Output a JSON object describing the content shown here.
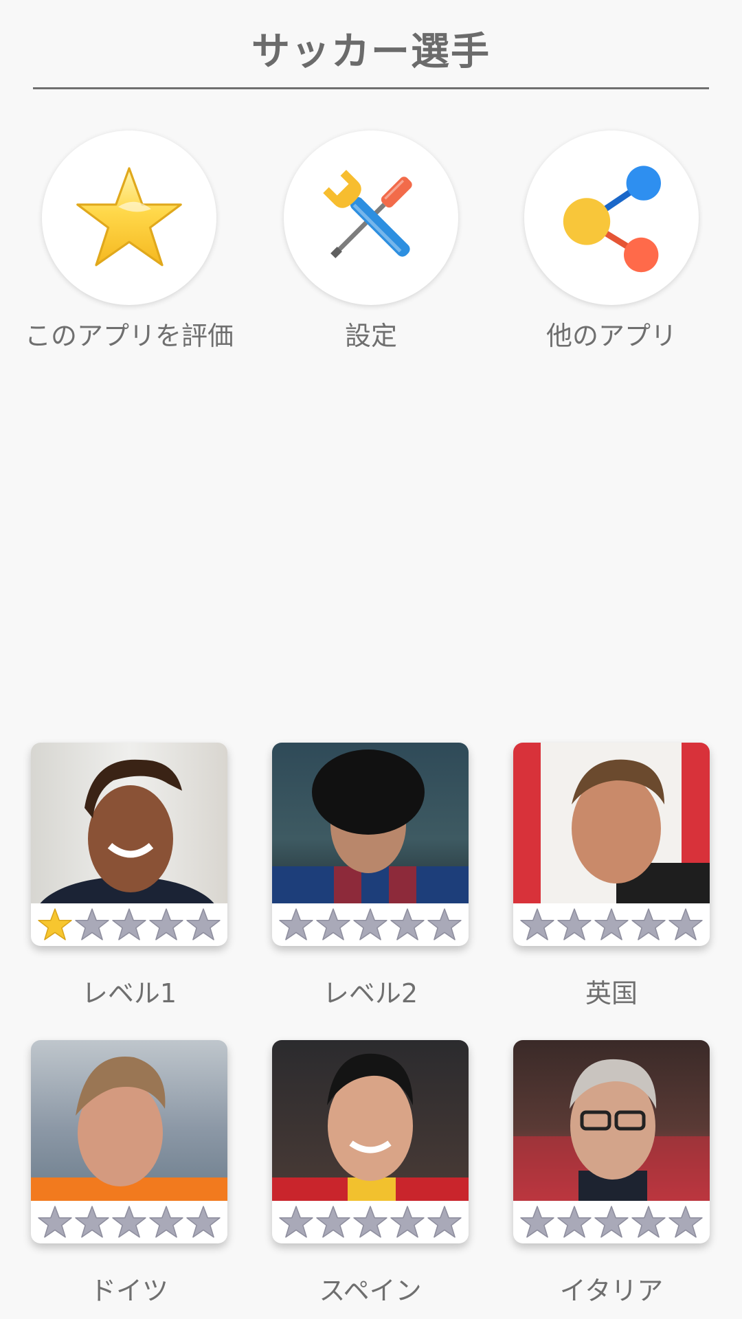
{
  "header": {
    "title": "サッカー選手"
  },
  "actions": [
    {
      "label": "このアプリを評価",
      "icon": "star-icon"
    },
    {
      "label": "設定",
      "icon": "tools-icon"
    },
    {
      "label": "他のアプリ",
      "icon": "share-icon"
    }
  ],
  "levels": [
    {
      "label": "レベル1",
      "stars_filled": 1,
      "stars_total": 5
    },
    {
      "label": "レベル2",
      "stars_filled": 0,
      "stars_total": 5
    },
    {
      "label": "英国",
      "stars_filled": 0,
      "stars_total": 5
    },
    {
      "label": "ドイツ",
      "stars_filled": 0,
      "stars_total": 5
    },
    {
      "label": "スペイン",
      "stars_filled": 0,
      "stars_total": 5
    },
    {
      "label": "イタリア",
      "stars_filled": 0,
      "stars_total": 5
    }
  ],
  "colors": {
    "star_filled": "#f7c62f",
    "star_empty": "#a9a9b8",
    "background": "#f8f8f8",
    "text": "#6f6f6f"
  }
}
